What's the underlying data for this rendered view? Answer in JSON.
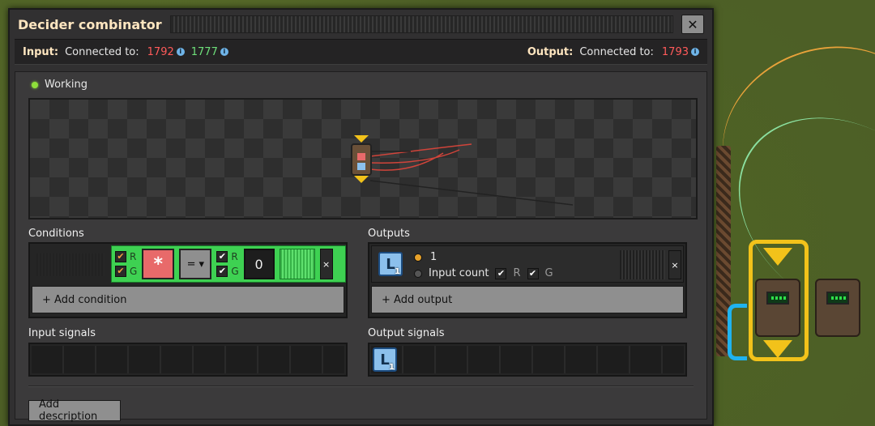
{
  "window": {
    "title": "Decider combinator",
    "close_glyph": "✕"
  },
  "connections": {
    "input_label": "Input:",
    "input_connected_text": "Connected to:",
    "input_red_id": "1792",
    "input_green_id": "1777",
    "output_label": "Output:",
    "output_connected_text": "Connected to:",
    "output_red_id": "1793"
  },
  "status": {
    "text": "Working",
    "color": "#8ee03a"
  },
  "conditions": {
    "title": "Conditions",
    "row": {
      "left_networks": {
        "r": "R",
        "g": "G",
        "r_checked": true,
        "g_checked": true
      },
      "signal_icon": "asterisk-signal-icon",
      "signal_glyph": "*",
      "comparator": "=",
      "right_networks": {
        "r": "R",
        "g": "G",
        "r_checked": true,
        "g_checked": true
      },
      "constant": "0",
      "remove_glyph": "×"
    },
    "add_label": "+ Add condition"
  },
  "outputs": {
    "title": "Outputs",
    "row": {
      "signal_letter": "L",
      "signal_count": "1",
      "option_one": "1",
      "option_input_count": "Input count",
      "r": "R",
      "g": "G",
      "selected_option": "1",
      "remove_glyph": "×"
    },
    "add_label": "+ Add output"
  },
  "input_signals": {
    "title": "Input signals"
  },
  "output_signals": {
    "title": "Output signals",
    "signals": [
      {
        "letter": "L",
        "count": "1"
      }
    ]
  },
  "description": {
    "button_label": "Add description"
  },
  "colors": {
    "accent_title": "#ffe6c0",
    "red_wire": "#ff5a5a",
    "green_wire": "#6ee07a",
    "condition_green": "#3ed152"
  }
}
